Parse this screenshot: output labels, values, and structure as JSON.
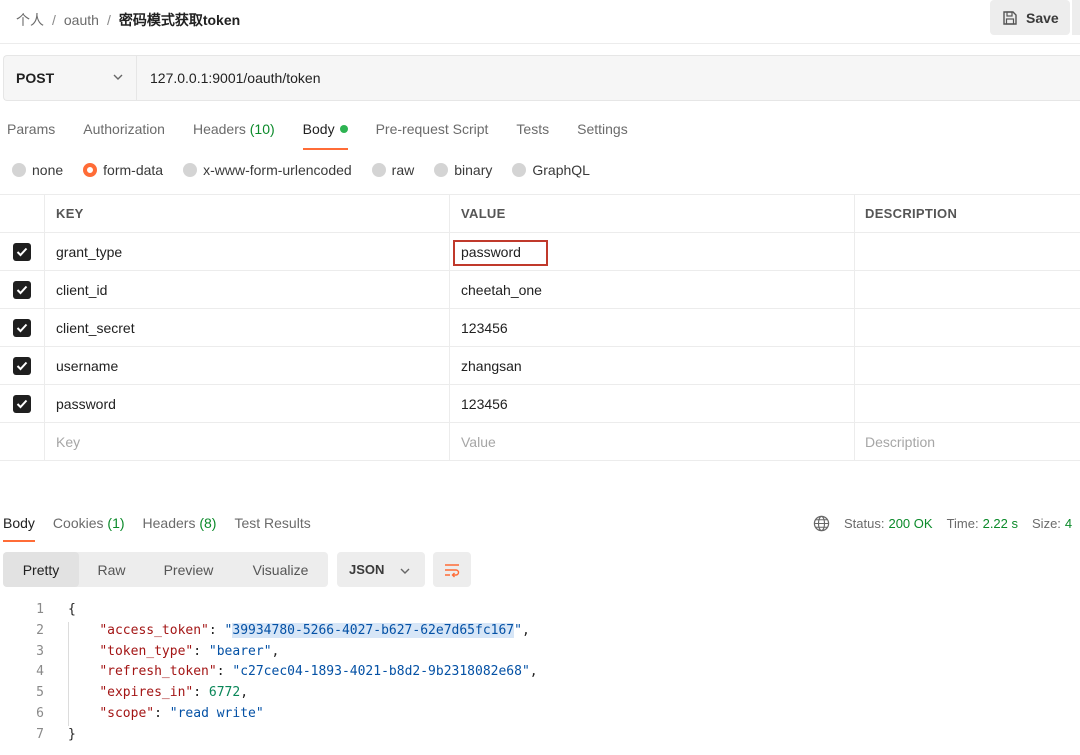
{
  "breadcrumb": {
    "part1": "个人",
    "sep": "/",
    "part2": "oauth",
    "current": "密码模式获取token"
  },
  "toolbar": {
    "save_label": "Save"
  },
  "request": {
    "method": "POST",
    "url": "127.0.0.1:9001/oauth/token"
  },
  "request_tabs": [
    {
      "label": "Params"
    },
    {
      "label": "Authorization"
    },
    {
      "label": "Headers",
      "count": "(10)"
    },
    {
      "label": "Body",
      "active": true
    },
    {
      "label": "Pre-request Script"
    },
    {
      "label": "Tests"
    },
    {
      "label": "Settings"
    }
  ],
  "body_types": [
    "none",
    "form-data",
    "x-www-form-urlencoded",
    "raw",
    "binary",
    "GraphQL"
  ],
  "body_type_selected": "form-data",
  "kv_table": {
    "headers": {
      "key": "KEY",
      "value": "VALUE",
      "description": "DESCRIPTION"
    },
    "rows": [
      {
        "key": "grant_type",
        "value": "password",
        "checked": true
      },
      {
        "key": "client_id",
        "value": "cheetah_one",
        "checked": true
      },
      {
        "key": "client_secret",
        "value": "123456",
        "checked": true
      },
      {
        "key": "username",
        "value": "zhangsan",
        "checked": true
      },
      {
        "key": "password",
        "value": "123456",
        "checked": true
      }
    ],
    "placeholders": {
      "key": "Key",
      "value": "Value",
      "description": "Description"
    }
  },
  "response_tabs": [
    {
      "label": "Body",
      "active": true
    },
    {
      "label": "Cookies",
      "count": "(1)"
    },
    {
      "label": "Headers",
      "count": "(8)"
    },
    {
      "label": "Test Results"
    }
  ],
  "response_status": {
    "status_label": "Status:",
    "status_value": "200 OK",
    "time_label": "Time:",
    "time_value": "2.22 s",
    "size_label": "Size:",
    "size_value": "4"
  },
  "view_tabs": [
    "Pretty",
    "Raw",
    "Preview",
    "Visualize"
  ],
  "view_selected": "Pretty",
  "format": "JSON",
  "response_json": {
    "access_token": "39934780-5266-4027-b627-62e7d65fc167",
    "token_type": "bearer",
    "refresh_token": "c27cec04-1893-4021-b8d2-9b2318082e68",
    "expires_in": "6772",
    "scope": "read write"
  },
  "line_numbers": [
    "1",
    "2",
    "3",
    "4",
    "5",
    "6",
    "7"
  ],
  "colors": {
    "accent": "#ff6c37",
    "success": "#0b8a2a",
    "highlight_border": "#c0392b"
  }
}
